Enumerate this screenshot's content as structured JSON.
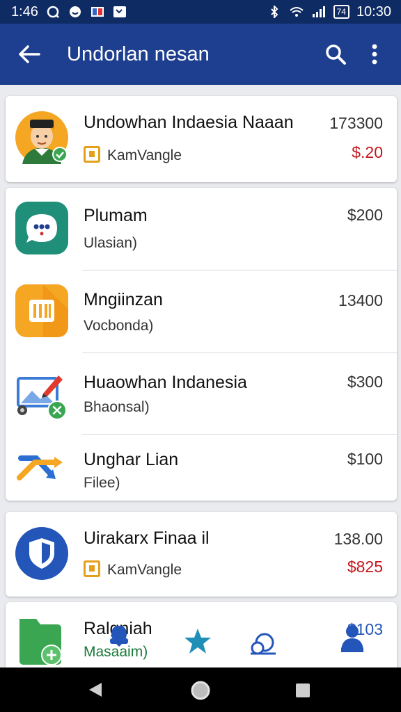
{
  "status_bar": {
    "time_left": "1:46",
    "time_right": "10:30",
    "battery_label": "74"
  },
  "app_bar": {
    "title": "Undorlan nesan"
  },
  "groups": [
    {
      "rows": [
        {
          "title": "Undowhan Indaesia Naaan",
          "sub": "KamVangle",
          "price_top": "173300",
          "price_bottom": "$.20",
          "icon": "person-avatar-icon"
        }
      ]
    },
    {
      "rows": [
        {
          "title": "Plumam",
          "sub": "Ulasian)",
          "price_top": "$200",
          "icon": "chat-bubble-icon"
        },
        {
          "title": "Mngiinzan",
          "sub": "Vocbonda)",
          "price_top": "13400",
          "icon": "barcode-tile-icon"
        },
        {
          "title": "Huaowhan Indanesia",
          "sub": "Bhaonsal)",
          "price_top": "$300",
          "icon": "picture-edit-icon"
        },
        {
          "title": "Unghar Lian",
          "sub": "Filee)",
          "price_top": "$100",
          "icon": "transfer-arrows-icon"
        }
      ]
    },
    {
      "rows": [
        {
          "title": "Uirakarx Finaa il",
          "sub": "KamVangle",
          "price_top": "138.00",
          "price_bottom": "$825",
          "icon": "shield-icon"
        }
      ]
    },
    {
      "rows": [
        {
          "title": "Ralgniah",
          "sub": "Masaaim)",
          "price_top": "$103",
          "icon": "folder-plus-icon"
        }
      ]
    }
  ],
  "colors": {
    "status_bar": "#0f2b63",
    "app_bar": "#1e3f8f",
    "price_red": "#c4161c",
    "badge": "#e5a019"
  }
}
